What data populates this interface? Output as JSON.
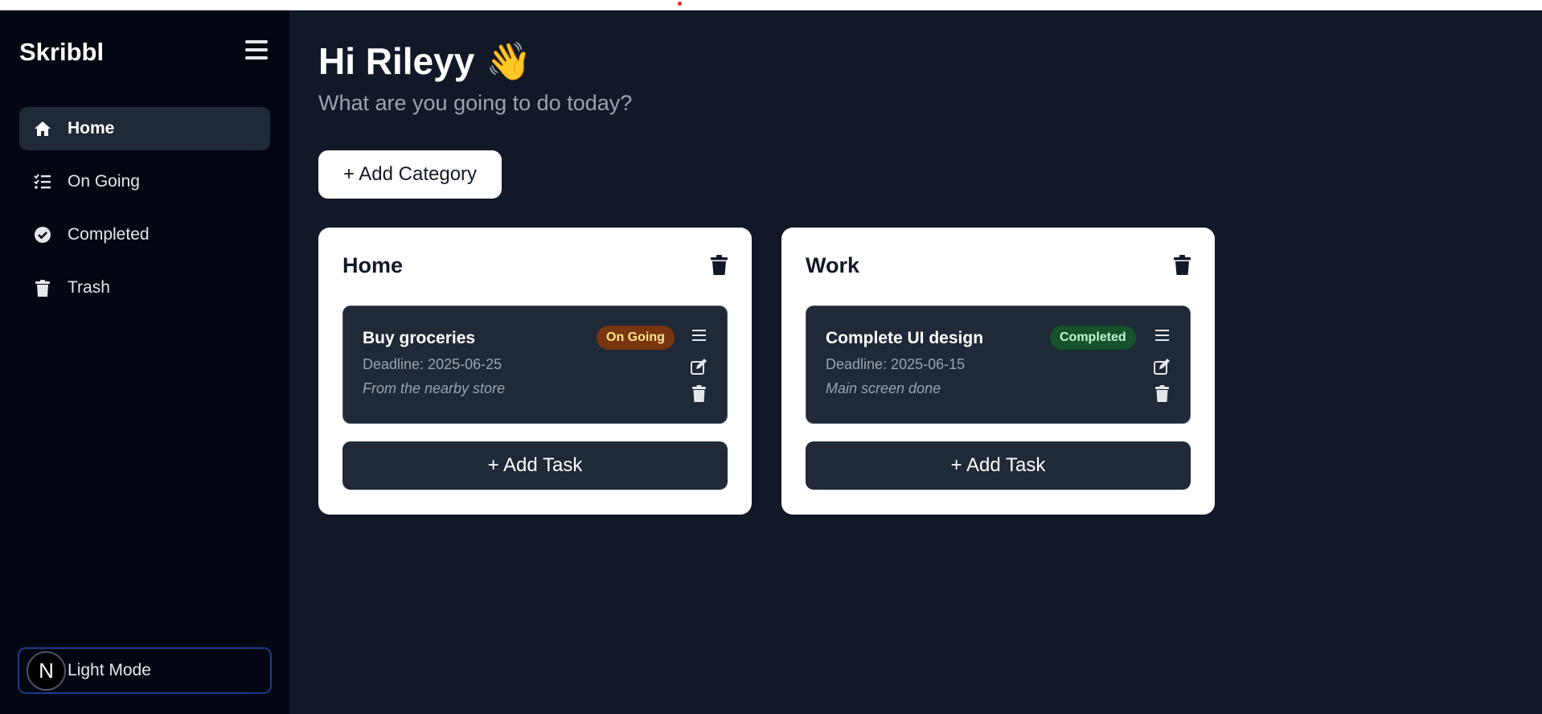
{
  "app": {
    "name": "Skribbl"
  },
  "sidebar": {
    "items": [
      {
        "label": "Home",
        "icon": "home-icon",
        "active": true
      },
      {
        "label": "On Going",
        "icon": "checklist-icon",
        "active": false
      },
      {
        "label": "Completed",
        "icon": "check-circle-icon",
        "active": false
      },
      {
        "label": "Trash",
        "icon": "trash-icon",
        "active": false
      }
    ],
    "mode_button": {
      "badge": "N",
      "label": "Light Mode"
    }
  },
  "main": {
    "greeting": "Hi Rileyy",
    "wave_emoji": "👋",
    "subtitle": "What are you going to do today?",
    "add_category_label": "+ Add Category",
    "categories": [
      {
        "title": "Home",
        "tasks": [
          {
            "title": "Buy groceries",
            "status": "On Going",
            "deadline": "Deadline: 2025-06-25",
            "description": "From the nearby store"
          }
        ],
        "add_task_label": "+ Add Task"
      },
      {
        "title": "Work",
        "tasks": [
          {
            "title": "Complete UI design",
            "status": "Completed",
            "deadline": "Deadline: 2025-06-15",
            "description": "Main screen done"
          }
        ],
        "add_task_label": "+ Add Task"
      }
    ]
  },
  "colors": {
    "sidebar_bg": "#030712",
    "main_bg": "#111827",
    "card_bg": "#ffffff",
    "task_bg": "#1f2937",
    "ongoing_badge": "#78350f",
    "completed_badge": "#14532d",
    "mode_border": "#1e3a8a"
  }
}
